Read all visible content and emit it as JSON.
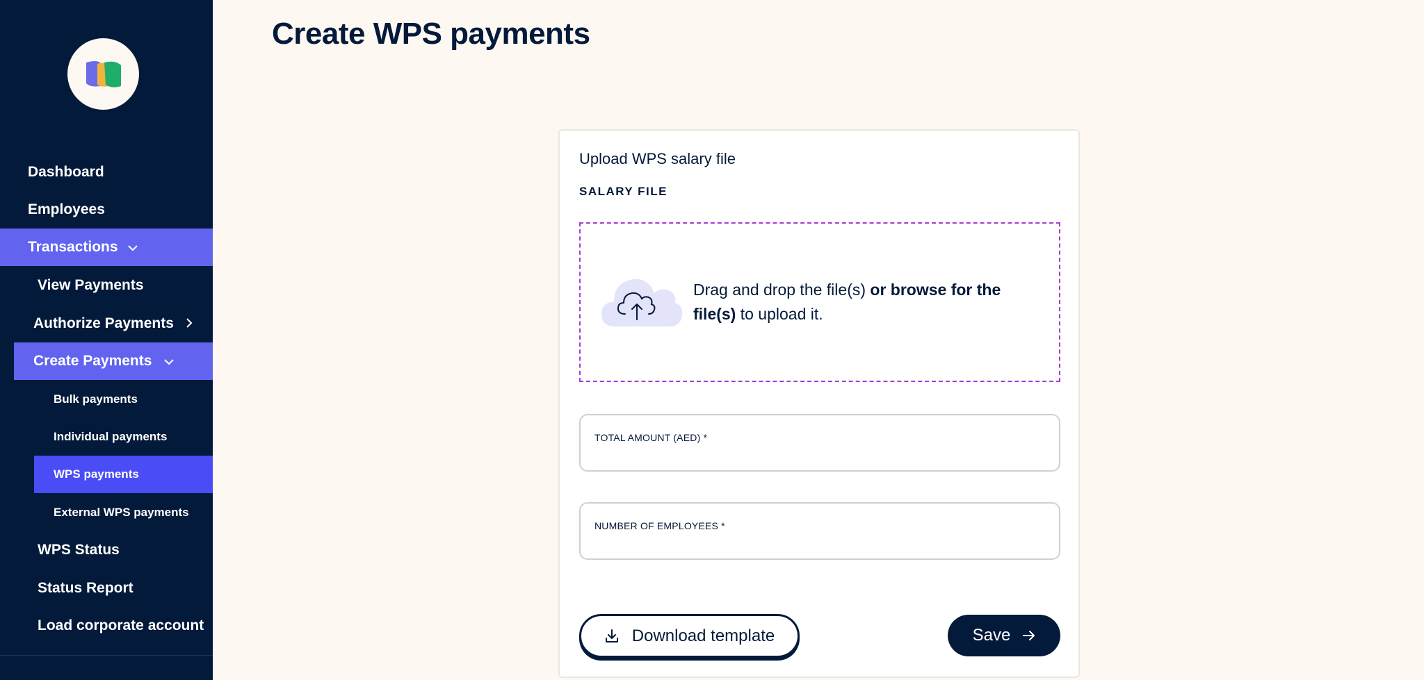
{
  "page": {
    "title": "Create WPS payments"
  },
  "sidebar": {
    "items": [
      {
        "label": "Dashboard"
      },
      {
        "label": "Employees"
      },
      {
        "label": "Transactions"
      },
      {
        "label": "View Payments"
      },
      {
        "label": "Authorize Payments"
      },
      {
        "label": "Create Payments"
      },
      {
        "label": "Bulk payments"
      },
      {
        "label": "Individual payments"
      },
      {
        "label": "WPS payments"
      },
      {
        "label": "External WPS payments"
      },
      {
        "label": "WPS Status"
      },
      {
        "label": "Status Report"
      },
      {
        "label": "Load corporate account"
      }
    ]
  },
  "form": {
    "card_title": "Upload WPS salary file",
    "section_label": "SALARY FILE",
    "dropzone": {
      "text_1": "Drag and drop the file(s) ",
      "text_bold": "or browse for the file(s)",
      "text_2": " to upload it."
    },
    "total_amount_label": "TOTAL AMOUNT (AED) *",
    "employees_label": "NUMBER OF EMPLOYEES *",
    "download_label": "Download template",
    "save_label": "Save"
  },
  "icons": {
    "logo": "brand-logo",
    "transactions_chevron": "chevron-down-icon",
    "authorize_chevron": "chevron-right-icon",
    "create_chevron": "chevron-down-icon",
    "upload": "cloud-upload-icon",
    "download": "download-icon",
    "save": "arrow-right-icon"
  },
  "colors": {
    "sidebar_bg": "#031a3a",
    "accent": "#6264f0",
    "active_subitem": "#4a4cf5",
    "page_bg": "#fdf8f2",
    "dropzone_border": "#a63dd6"
  }
}
